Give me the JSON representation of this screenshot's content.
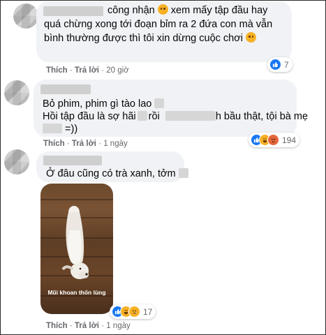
{
  "comments": [
    {
      "text_lines": [
        "công nhận",
        "xem mấy tập đầu hay",
        "quá chừng xong tới đoạn bỉm ra 2 đứa con mà vẫn",
        "bình thường được thì tôi xin dừng cuộc chơi"
      ],
      "like_label": "Thích",
      "reply_label": "Trả lời",
      "time": "20 giờ",
      "reaction_count": "7"
    },
    {
      "text_lines": [
        "Bỏ phim, phim gì tào lao",
        "Hồi tập đầu là sợ hãi",
        "rồi",
        "h bầu thật, tội bà mẹ",
        "=))"
      ],
      "like_label": "Thích",
      "reply_label": "Trả lời",
      "time": "1 ngày",
      "reaction_count": "194"
    },
    {
      "text_lines": [
        "Ở đâu cũng có trà xanh, tởm"
      ],
      "photo_caption": "Mũi khoan thốn lùng",
      "like_label": "Thích",
      "reply_label": "Trả lời",
      "time": "1 ngày",
      "reaction_count": "17"
    }
  ],
  "colors": {
    "bubble": "#f0f2f5",
    "meta": "#65676b",
    "like": "#1877f2",
    "haha": "#f7b125",
    "angry": "#e4653a"
  },
  "icons": [
    "like-reaction-icon",
    "haha-reaction-icon",
    "angry-reaction-icon",
    "sad-reaction-icon"
  ],
  "separator": "·"
}
